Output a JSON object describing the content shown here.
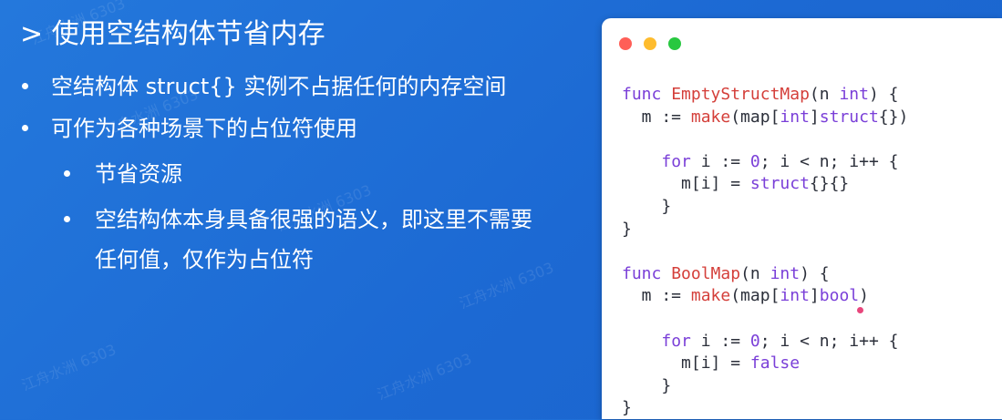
{
  "slide": {
    "title": "> 使用空结构体节省内存",
    "bullets": [
      "空结构体 struct{} 实例不占据任何的内存空间",
      "可作为各种场景下的占位符使用"
    ],
    "sub_bullets": [
      "节省资源",
      "空结构体本身具备很强的语义，即这里不需要",
      "任何值，仅作为占位符"
    ],
    "watermark": "江舟水洲 6303"
  },
  "code_window": {
    "traffic_lights": {
      "red": "#ff5f57",
      "yellow": "#febc2e",
      "green": "#28c840"
    },
    "lines": [
      [
        [
          "kw",
          "func"
        ],
        [
          "pl",
          " "
        ],
        [
          "fn",
          "EmptyStructMap"
        ],
        [
          "pl",
          "(n "
        ],
        [
          "kw",
          "int"
        ],
        [
          "pl",
          ") {"
        ]
      ],
      [
        [
          "pl",
          "  m := "
        ],
        [
          "fn",
          "make"
        ],
        [
          "pl",
          "(map["
        ],
        [
          "kw",
          "int"
        ],
        [
          "pl",
          "]"
        ],
        [
          "kw",
          "struct"
        ],
        [
          "pl",
          "{})"
        ]
      ],
      [],
      [
        [
          "pl",
          "    "
        ],
        [
          "kw",
          "for"
        ],
        [
          "pl",
          " i := "
        ],
        [
          "kw",
          "0"
        ],
        [
          "pl",
          "; i < n; i++ {"
        ]
      ],
      [
        [
          "pl",
          "      m[i] = "
        ],
        [
          "kw",
          "struct"
        ],
        [
          "pl",
          "{}{}"
        ]
      ],
      [
        [
          "pl",
          "    }"
        ]
      ],
      [
        [
          "pl",
          "}"
        ]
      ],
      [],
      [
        [
          "kw",
          "func"
        ],
        [
          "pl",
          " "
        ],
        [
          "fn",
          "BoolMap"
        ],
        [
          "pl",
          "(n "
        ],
        [
          "kw",
          "int"
        ],
        [
          "pl",
          ") {"
        ]
      ],
      [
        [
          "pl",
          "  m := "
        ],
        [
          "fn",
          "make"
        ],
        [
          "pl",
          "(map["
        ],
        [
          "kw",
          "int"
        ],
        [
          "pl",
          "]"
        ],
        [
          "kw",
          "bool"
        ],
        [
          "pl",
          ")"
        ]
      ],
      [],
      [
        [
          "pl",
          "    "
        ],
        [
          "kw",
          "for"
        ],
        [
          "pl",
          " i := "
        ],
        [
          "kw",
          "0"
        ],
        [
          "pl",
          "; i < n; i++ {"
        ]
      ],
      [
        [
          "pl",
          "      m[i] = "
        ],
        [
          "kw",
          "false"
        ]
      ],
      [
        [
          "pl",
          "    }"
        ]
      ],
      [
        [
          "pl",
          "}"
        ]
      ]
    ]
  }
}
